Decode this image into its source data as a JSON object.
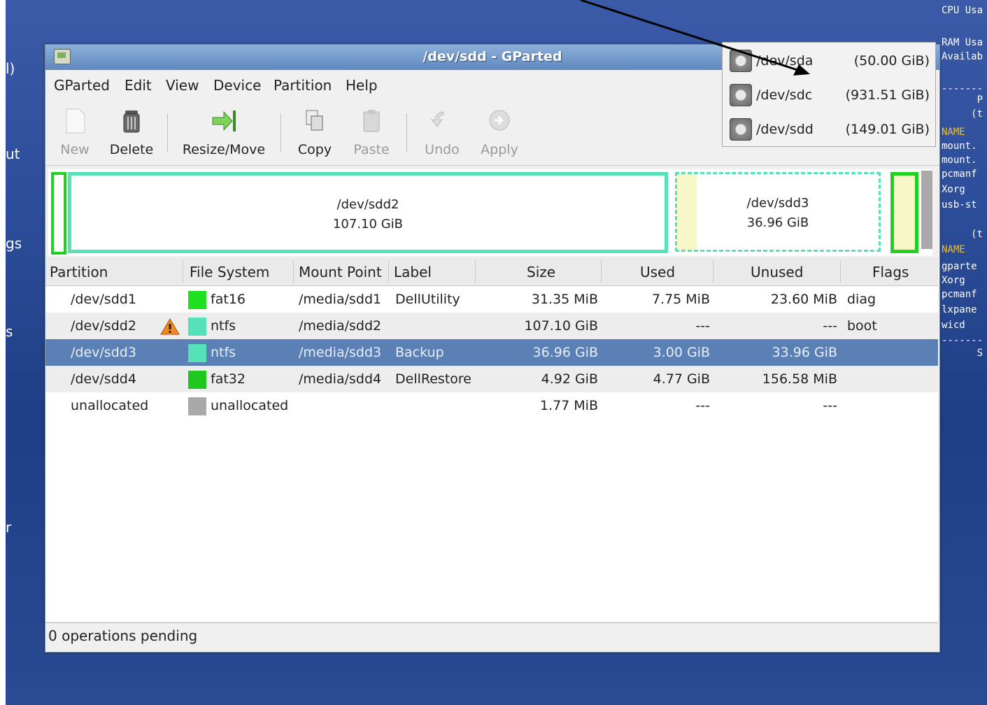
{
  "window": {
    "title": "/dev/sdd - GParted"
  },
  "menu": [
    "GParted",
    "Edit",
    "View",
    "Device",
    "Partition",
    "Help"
  ],
  "toolbar": {
    "new": "New",
    "delete": "Delete",
    "resize": "Resize/Move",
    "copy": "Copy",
    "paste": "Paste",
    "undo": "Undo",
    "apply": "Apply"
  },
  "diskmap": {
    "sdd2": {
      "name": "/dev/sdd2",
      "size": "107.10 GiB"
    },
    "sdd3": {
      "name": "/dev/sdd3",
      "size": "36.96 GiB"
    }
  },
  "columns": [
    "Partition",
    "File System",
    "Mount Point",
    "Label",
    "Size",
    "Used",
    "Unused",
    "Flags"
  ],
  "rows": [
    {
      "partition": "/dev/sdd1",
      "fs": "fat16",
      "fs_color": "#1fe01f",
      "mount": "/media/sdd1",
      "label": "DellUtility",
      "size": "31.35 MiB",
      "used": "7.75 MiB",
      "unused": "23.60 MiB",
      "flags": "diag"
    },
    {
      "partition": "/dev/sdd2",
      "fs": "ntfs",
      "fs_color": "#55e2b8",
      "mount": "/media/sdd2",
      "label": "",
      "size": "107.10 GiB",
      "used": "---",
      "unused": "---",
      "flags": "boot"
    },
    {
      "partition": "/dev/sdd3",
      "fs": "ntfs",
      "fs_color": "#55e2b8",
      "mount": "/media/sdd3",
      "label": "Backup",
      "size": "36.96 GiB",
      "used": "3.00 GiB",
      "unused": "33.96 GiB",
      "flags": ""
    },
    {
      "partition": "/dev/sdd4",
      "fs": "fat32",
      "fs_color": "#1fc81f",
      "mount": "/media/sdd4",
      "label": "DellRestore",
      "size": "4.92 GiB",
      "used": "4.77 GiB",
      "unused": "156.58 MiB",
      "flags": ""
    },
    {
      "partition": "unallocated",
      "fs": "unallocated",
      "fs_color": "#a9a9a9",
      "mount": "",
      "label": "",
      "size": "1.77 MiB",
      "used": "---",
      "unused": "---",
      "flags": ""
    }
  ],
  "status": "0 operations pending",
  "devices": [
    {
      "name": "/dev/sda",
      "size": "(50.00 GiB)"
    },
    {
      "name": "/dev/sdc",
      "size": "(931.51 GiB)"
    },
    {
      "name": "/dev/sdd",
      "size": "(149.01 GiB)"
    }
  ],
  "desktop_left": [
    "l)",
    "ut",
    "gs",
    "s",
    "r"
  ],
  "conky": [
    "CPU Usa",
    "",
    "RAM Usa",
    "Availab",
    "",
    "-------",
    "      P",
    "     (t",
    "NAME",
    "mount.",
    "mount.",
    "pcmanf",
    "Xorg",
    "usb-st",
    "",
    "     (t",
    "NAME",
    "gparte",
    "Xorg",
    "pcmanf",
    "lxpane",
    "wicd",
    "-------",
    "      S"
  ]
}
